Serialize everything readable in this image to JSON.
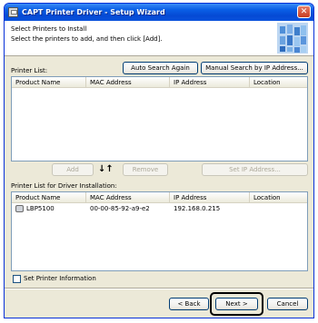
{
  "window": {
    "title": "CAPT Printer Driver - Setup Wizard",
    "close_glyph": "✕"
  },
  "header": {
    "title": "Select Printers to Install",
    "subtitle": "Select the printers to add, and then click [Add]."
  },
  "printer_list": {
    "label": "Printer List:",
    "auto_search": "Auto Search Again",
    "manual_search": "Manual Search by IP Address...",
    "columns": [
      "Product Name",
      "MAC Address",
      "IP Address",
      "Location"
    ]
  },
  "actions": {
    "add": "Add",
    "arrows": "↓↑",
    "remove": "Remove",
    "set_ip": "Set IP Address..."
  },
  "install_list": {
    "label": "Printer List for Driver Installation:",
    "columns": [
      "Product Name",
      "MAC Address",
      "IP Address",
      "Location"
    ],
    "rows": [
      {
        "product": "LBP5100",
        "mac": "00-00-85-92-a9-e2",
        "ip": "192.168.0.215",
        "location": ""
      }
    ]
  },
  "options": {
    "set_printer_info": "Set Printer Information",
    "checked": false
  },
  "footer": {
    "back": "< Back",
    "next": "Next >",
    "cancel": "Cancel"
  },
  "colors": {
    "titlebar": "#0549d4",
    "window_bg": "#ece9d8",
    "list_border": "#7f9db9"
  }
}
